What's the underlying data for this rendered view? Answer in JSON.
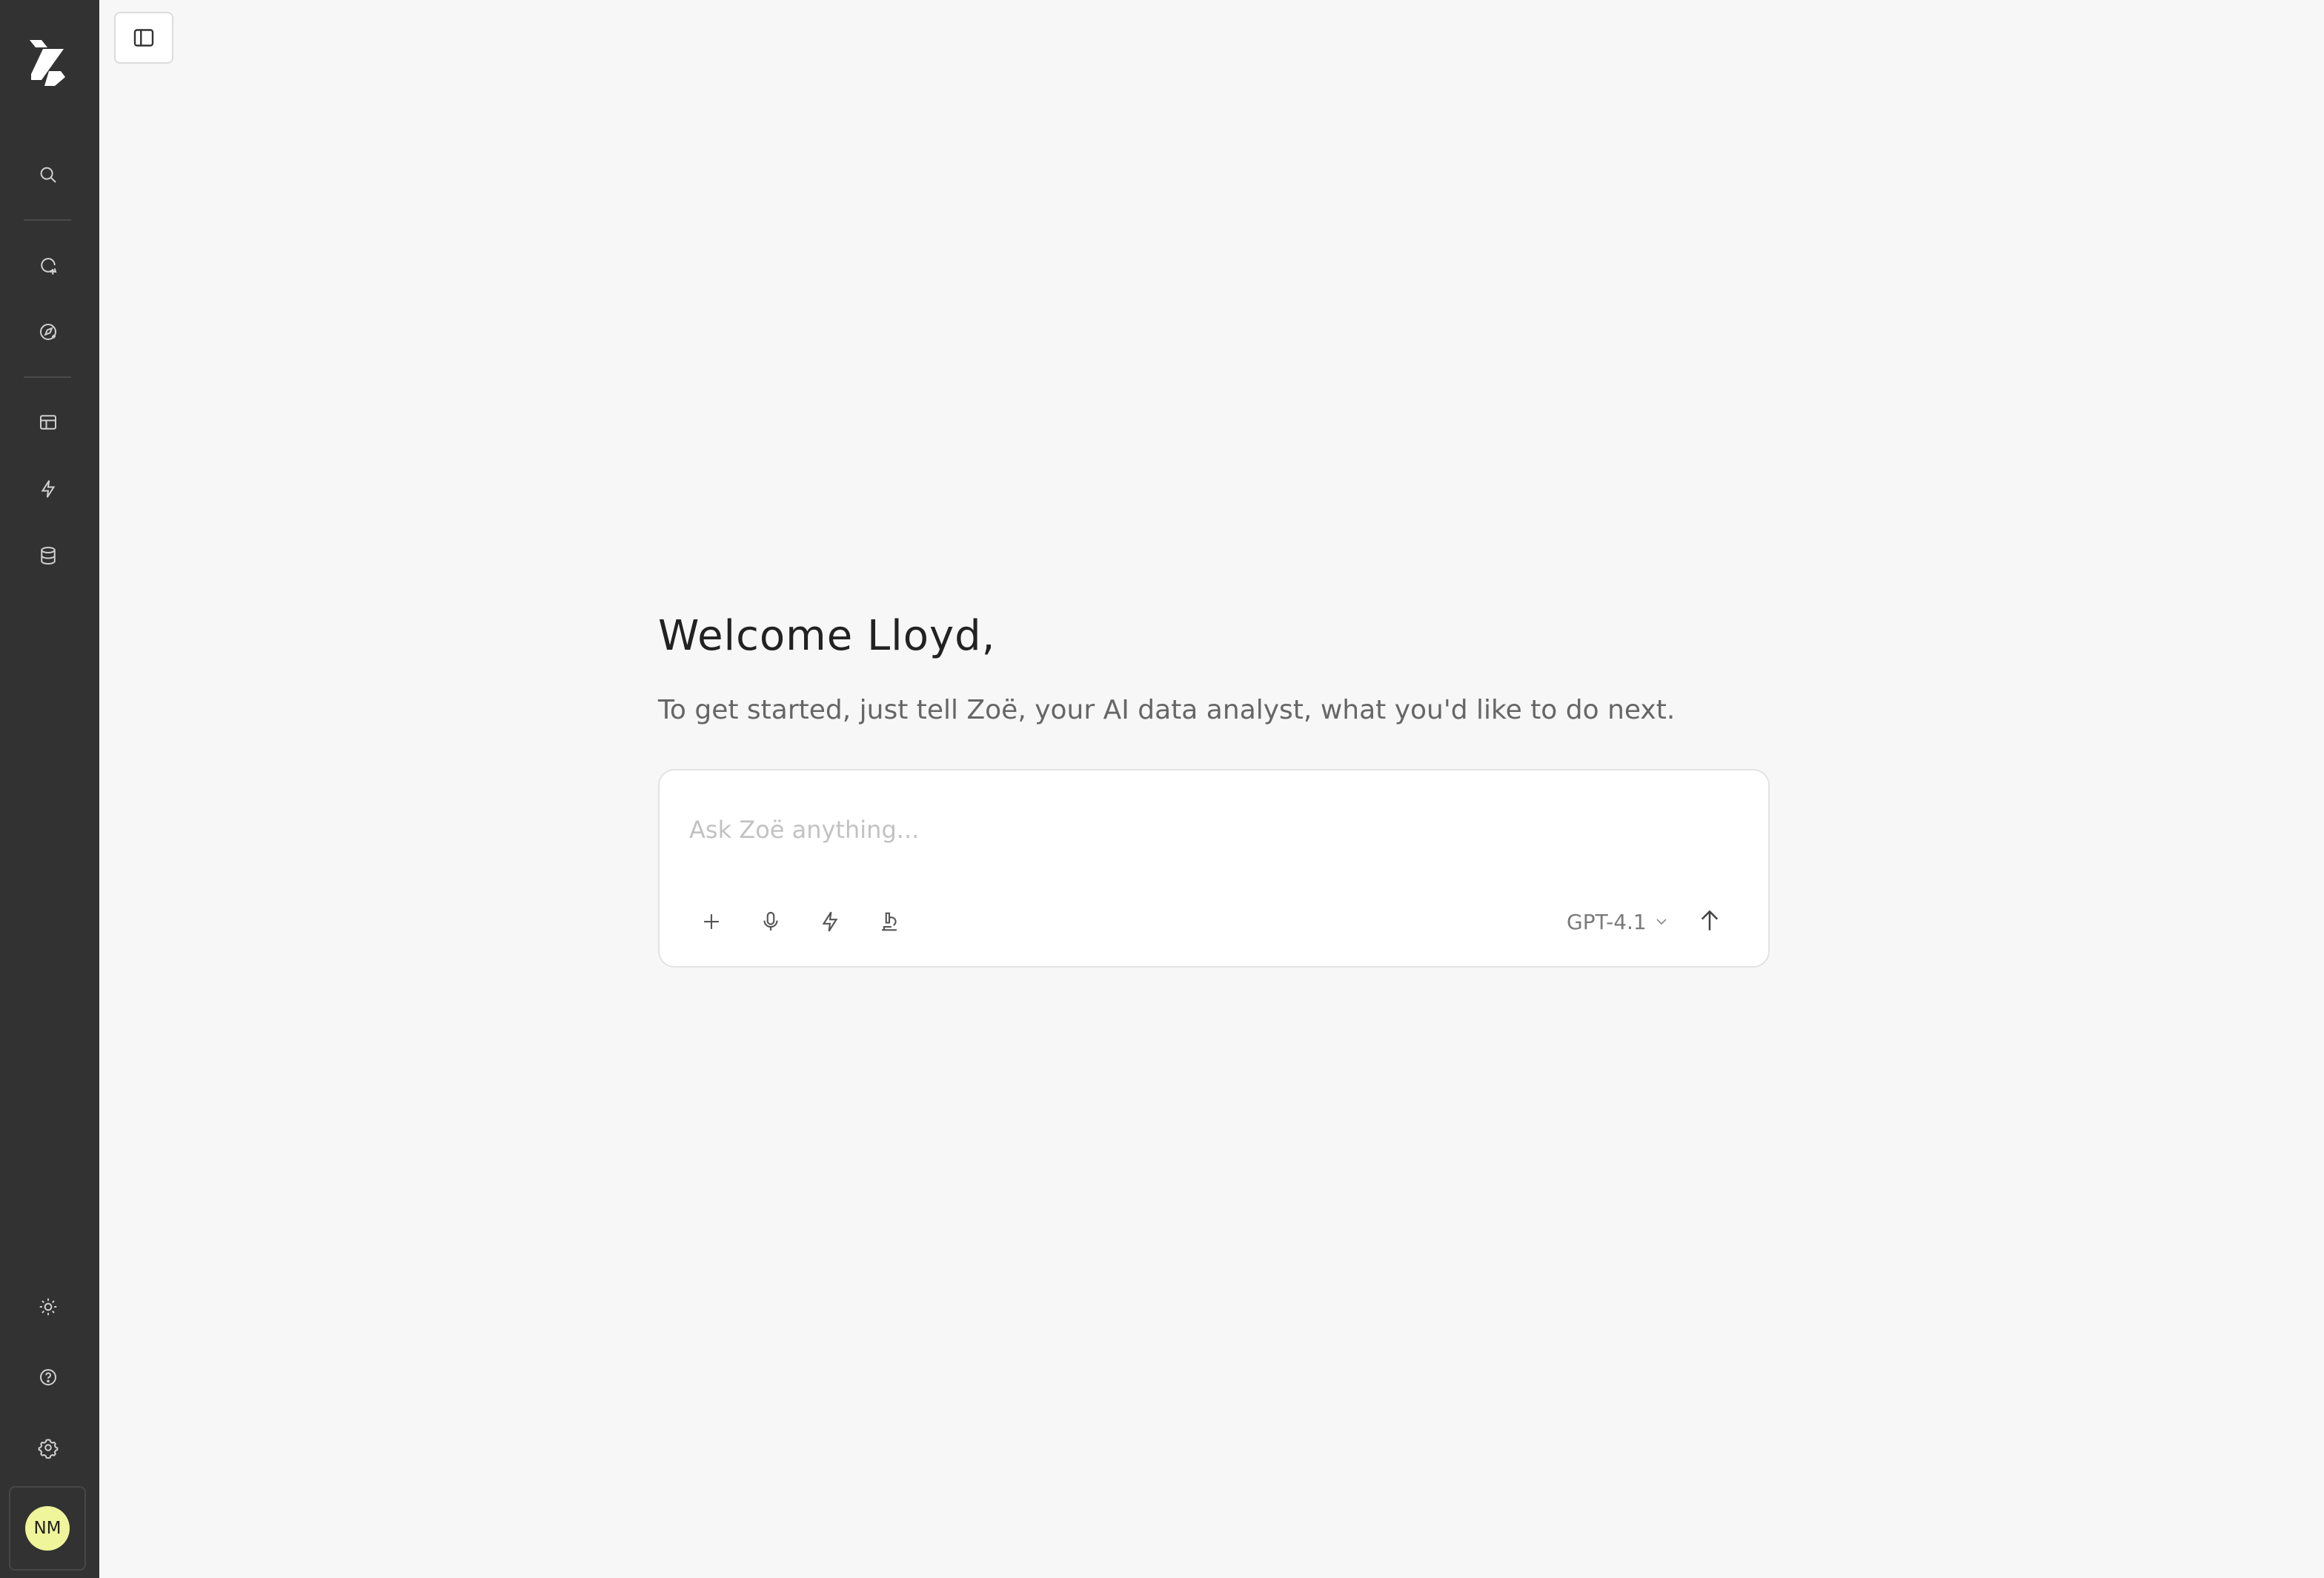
{
  "sidebar": {
    "avatar_initials": "NM",
    "avatar_color": "#eef59b",
    "background": "#323232",
    "icons": [
      "logo-icon",
      "search-icon",
      "new-chat-icon",
      "explore-icon",
      "table-icon",
      "bolt-icon",
      "database-icon",
      "sun-icon",
      "help-icon",
      "settings-icon"
    ]
  },
  "main": {
    "title": "Welcome Lloyd,",
    "subtitle": "To get started, just tell Zoë, your AI data analyst, what you'd like to do next."
  },
  "composer": {
    "placeholder": "Ask Zoë anything...",
    "value": "",
    "model": "GPT-4.1"
  }
}
